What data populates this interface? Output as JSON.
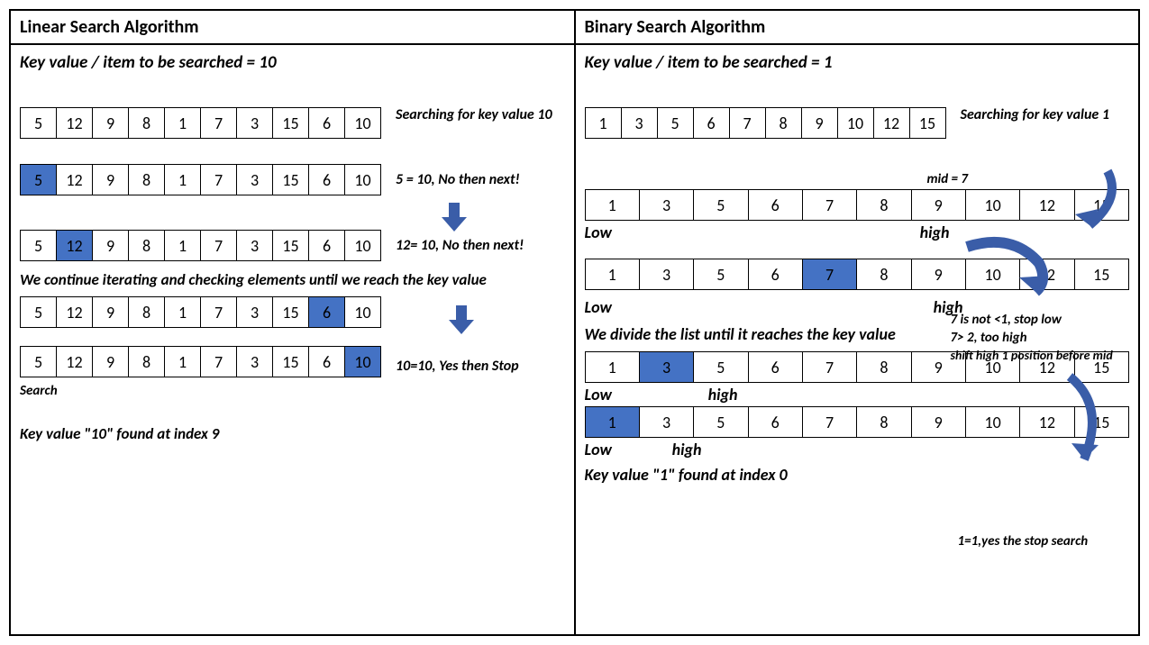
{
  "colors": {
    "highlight": "#4472c4",
    "arrow": "#3a5da8"
  },
  "left": {
    "title": "Linear Search  Algorithm",
    "subtitle": "Key value / item to be searched = 10",
    "arrays": {
      "a1": [
        5,
        12,
        9,
        8,
        1,
        7,
        3,
        15,
        6,
        10
      ],
      "a2": [
        5,
        12,
        9,
        8,
        1,
        7,
        3,
        15,
        6,
        10
      ],
      "a3": [
        5,
        12,
        9,
        8,
        1,
        7,
        3,
        15,
        6,
        10
      ],
      "a4": [
        5,
        12,
        9,
        8,
        1,
        7,
        3,
        15,
        6,
        10
      ],
      "a5": [
        5,
        12,
        9,
        8,
        1,
        7,
        3,
        15,
        6,
        10
      ]
    },
    "highlights": {
      "a2": 0,
      "a3": 1,
      "a4": 8,
      "a5": 9
    },
    "captions": {
      "c1": "Searching for key value 10",
      "c2": "5 = 10, No then next!",
      "c3": "12= 10, No then next!",
      "iter": "We continue iterating and checking elements until we reach the key value",
      "c5": "10=10, Yes then Stop",
      "search": "Search",
      "found": "Key value \"10\" found at index 9"
    }
  },
  "right": {
    "title": "Binary Search Algorithm",
    "subtitle": "Key value / item to be searched = 1",
    "arrays": {
      "b1": [
        1,
        3,
        5,
        6,
        7,
        8,
        9,
        10,
        12,
        15
      ],
      "b2": [
        1,
        3,
        5,
        6,
        7,
        8,
        9,
        10,
        12,
        15
      ],
      "b3": [
        1,
        3,
        5,
        6,
        7,
        8,
        9,
        10,
        12,
        15
      ],
      "b4": [
        1,
        3,
        5,
        6,
        7,
        8,
        9,
        10,
        12,
        15
      ],
      "b5": [
        1,
        3,
        5,
        6,
        7,
        8,
        9,
        10,
        12,
        15
      ]
    },
    "highlights": {
      "b3": 4,
      "b4": 1,
      "b5": 0
    },
    "captions": {
      "c1": "Searching for key value 1",
      "mid": "mid = 7",
      "low": "Low",
      "high": "high",
      "n1": "7 is not <1, stop low",
      "n2": "7> 2, too high",
      "n3": "shift high 1 position before mid",
      "divide": "We divide the list until it reaches the key value",
      "stop": "1=1,yes the stop search",
      "found": "Key value \"1\" found at index 0"
    }
  }
}
